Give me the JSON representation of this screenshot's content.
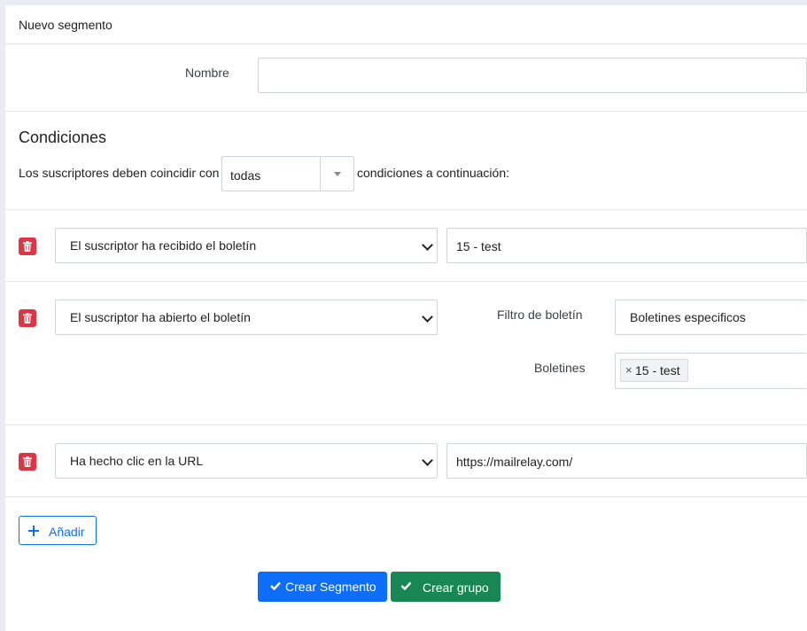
{
  "page": {
    "title": "Nuevo segmento"
  },
  "form": {
    "name_label": "Nombre",
    "name_value": ""
  },
  "conditions": {
    "heading": "Condiciones",
    "match_prefix": "Los suscriptores deben coincidir con",
    "match_value": "todas",
    "match_suffix": "condiciones a continuación:",
    "rows": [
      {
        "type": "El suscriptor ha recibido el boletín",
        "value": "15 - test"
      },
      {
        "type": "El suscriptor ha abierto el boletín",
        "filter_label": "Filtro de boletín",
        "filter_value": "Boletines especificos",
        "newsletters_label": "Boletines",
        "newsletters": [
          {
            "remove": "×",
            "label": "15 - test"
          }
        ]
      },
      {
        "type": "Ha hecho clic en la URL",
        "value": "https://mailrelay.com/"
      }
    ]
  },
  "actions": {
    "add_label": "Añadir",
    "create_segment_label": "Crear Segmento",
    "create_group_label": "Crear grupo"
  },
  "colors": {
    "danger": "#dc3545",
    "primary": "#0d6efd",
    "success": "#198754"
  },
  "icons": {
    "delete": "trash-icon",
    "add": "plus-icon",
    "check": "check-icon",
    "dropdown": "caret-down-icon"
  }
}
